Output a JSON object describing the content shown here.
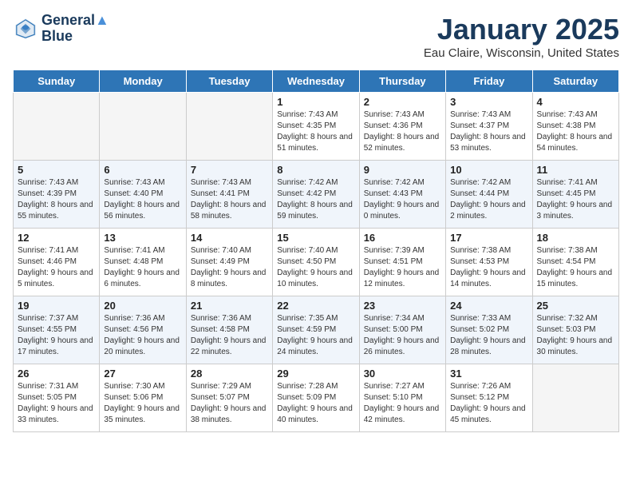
{
  "logo": {
    "line1": "General",
    "line2": "Blue"
  },
  "title": "January 2025",
  "location": "Eau Claire, Wisconsin, United States",
  "days_of_week": [
    "Sunday",
    "Monday",
    "Tuesday",
    "Wednesday",
    "Thursday",
    "Friday",
    "Saturday"
  ],
  "weeks": [
    [
      {
        "day": "",
        "sunrise": "",
        "sunset": "",
        "daylight": ""
      },
      {
        "day": "",
        "sunrise": "",
        "sunset": "",
        "daylight": ""
      },
      {
        "day": "",
        "sunrise": "",
        "sunset": "",
        "daylight": ""
      },
      {
        "day": "1",
        "sunrise": "Sunrise: 7:43 AM",
        "sunset": "Sunset: 4:35 PM",
        "daylight": "Daylight: 8 hours and 51 minutes."
      },
      {
        "day": "2",
        "sunrise": "Sunrise: 7:43 AM",
        "sunset": "Sunset: 4:36 PM",
        "daylight": "Daylight: 8 hours and 52 minutes."
      },
      {
        "day": "3",
        "sunrise": "Sunrise: 7:43 AM",
        "sunset": "Sunset: 4:37 PM",
        "daylight": "Daylight: 8 hours and 53 minutes."
      },
      {
        "day": "4",
        "sunrise": "Sunrise: 7:43 AM",
        "sunset": "Sunset: 4:38 PM",
        "daylight": "Daylight: 8 hours and 54 minutes."
      }
    ],
    [
      {
        "day": "5",
        "sunrise": "Sunrise: 7:43 AM",
        "sunset": "Sunset: 4:39 PM",
        "daylight": "Daylight: 8 hours and 55 minutes."
      },
      {
        "day": "6",
        "sunrise": "Sunrise: 7:43 AM",
        "sunset": "Sunset: 4:40 PM",
        "daylight": "Daylight: 8 hours and 56 minutes."
      },
      {
        "day": "7",
        "sunrise": "Sunrise: 7:43 AM",
        "sunset": "Sunset: 4:41 PM",
        "daylight": "Daylight: 8 hours and 58 minutes."
      },
      {
        "day": "8",
        "sunrise": "Sunrise: 7:42 AM",
        "sunset": "Sunset: 4:42 PM",
        "daylight": "Daylight: 8 hours and 59 minutes."
      },
      {
        "day": "9",
        "sunrise": "Sunrise: 7:42 AM",
        "sunset": "Sunset: 4:43 PM",
        "daylight": "Daylight: 9 hours and 0 minutes."
      },
      {
        "day": "10",
        "sunrise": "Sunrise: 7:42 AM",
        "sunset": "Sunset: 4:44 PM",
        "daylight": "Daylight: 9 hours and 2 minutes."
      },
      {
        "day": "11",
        "sunrise": "Sunrise: 7:41 AM",
        "sunset": "Sunset: 4:45 PM",
        "daylight": "Daylight: 9 hours and 3 minutes."
      }
    ],
    [
      {
        "day": "12",
        "sunrise": "Sunrise: 7:41 AM",
        "sunset": "Sunset: 4:46 PM",
        "daylight": "Daylight: 9 hours and 5 minutes."
      },
      {
        "day": "13",
        "sunrise": "Sunrise: 7:41 AM",
        "sunset": "Sunset: 4:48 PM",
        "daylight": "Daylight: 9 hours and 6 minutes."
      },
      {
        "day": "14",
        "sunrise": "Sunrise: 7:40 AM",
        "sunset": "Sunset: 4:49 PM",
        "daylight": "Daylight: 9 hours and 8 minutes."
      },
      {
        "day": "15",
        "sunrise": "Sunrise: 7:40 AM",
        "sunset": "Sunset: 4:50 PM",
        "daylight": "Daylight: 9 hours and 10 minutes."
      },
      {
        "day": "16",
        "sunrise": "Sunrise: 7:39 AM",
        "sunset": "Sunset: 4:51 PM",
        "daylight": "Daylight: 9 hours and 12 minutes."
      },
      {
        "day": "17",
        "sunrise": "Sunrise: 7:38 AM",
        "sunset": "Sunset: 4:53 PM",
        "daylight": "Daylight: 9 hours and 14 minutes."
      },
      {
        "day": "18",
        "sunrise": "Sunrise: 7:38 AM",
        "sunset": "Sunset: 4:54 PM",
        "daylight": "Daylight: 9 hours and 15 minutes."
      }
    ],
    [
      {
        "day": "19",
        "sunrise": "Sunrise: 7:37 AM",
        "sunset": "Sunset: 4:55 PM",
        "daylight": "Daylight: 9 hours and 17 minutes."
      },
      {
        "day": "20",
        "sunrise": "Sunrise: 7:36 AM",
        "sunset": "Sunset: 4:56 PM",
        "daylight": "Daylight: 9 hours and 20 minutes."
      },
      {
        "day": "21",
        "sunrise": "Sunrise: 7:36 AM",
        "sunset": "Sunset: 4:58 PM",
        "daylight": "Daylight: 9 hours and 22 minutes."
      },
      {
        "day": "22",
        "sunrise": "Sunrise: 7:35 AM",
        "sunset": "Sunset: 4:59 PM",
        "daylight": "Daylight: 9 hours and 24 minutes."
      },
      {
        "day": "23",
        "sunrise": "Sunrise: 7:34 AM",
        "sunset": "Sunset: 5:00 PM",
        "daylight": "Daylight: 9 hours and 26 minutes."
      },
      {
        "day": "24",
        "sunrise": "Sunrise: 7:33 AM",
        "sunset": "Sunset: 5:02 PM",
        "daylight": "Daylight: 9 hours and 28 minutes."
      },
      {
        "day": "25",
        "sunrise": "Sunrise: 7:32 AM",
        "sunset": "Sunset: 5:03 PM",
        "daylight": "Daylight: 9 hours and 30 minutes."
      }
    ],
    [
      {
        "day": "26",
        "sunrise": "Sunrise: 7:31 AM",
        "sunset": "Sunset: 5:05 PM",
        "daylight": "Daylight: 9 hours and 33 minutes."
      },
      {
        "day": "27",
        "sunrise": "Sunrise: 7:30 AM",
        "sunset": "Sunset: 5:06 PM",
        "daylight": "Daylight: 9 hours and 35 minutes."
      },
      {
        "day": "28",
        "sunrise": "Sunrise: 7:29 AM",
        "sunset": "Sunset: 5:07 PM",
        "daylight": "Daylight: 9 hours and 38 minutes."
      },
      {
        "day": "29",
        "sunrise": "Sunrise: 7:28 AM",
        "sunset": "Sunset: 5:09 PM",
        "daylight": "Daylight: 9 hours and 40 minutes."
      },
      {
        "day": "30",
        "sunrise": "Sunrise: 7:27 AM",
        "sunset": "Sunset: 5:10 PM",
        "daylight": "Daylight: 9 hours and 42 minutes."
      },
      {
        "day": "31",
        "sunrise": "Sunrise: 7:26 AM",
        "sunset": "Sunset: 5:12 PM",
        "daylight": "Daylight: 9 hours and 45 minutes."
      },
      {
        "day": "",
        "sunrise": "",
        "sunset": "",
        "daylight": ""
      }
    ]
  ]
}
